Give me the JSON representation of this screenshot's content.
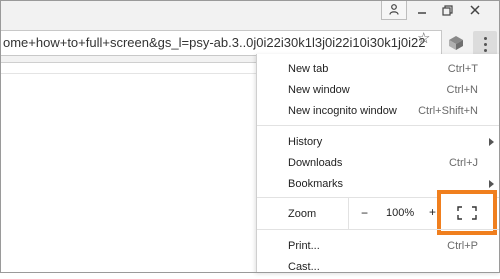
{
  "window": {
    "controls": [
      "user-icon",
      "minimize-icon",
      "maximize-icon",
      "close-icon"
    ]
  },
  "toolbar": {
    "url": "ome+how+to+full+screen&gs_l=psy-ab.3..0j0i22i30k1l3j0i22i10i30k1j0i22",
    "icons": [
      "star-icon",
      "extension-icon",
      "menu-icon"
    ]
  },
  "menu": {
    "new_tab": {
      "label": "New tab",
      "shortcut": "Ctrl+T"
    },
    "new_window": {
      "label": "New window",
      "shortcut": "Ctrl+N"
    },
    "new_incognito": {
      "label": "New incognito window",
      "shortcut": "Ctrl+Shift+N"
    },
    "history": {
      "label": "History"
    },
    "downloads": {
      "label": "Downloads",
      "shortcut": "Ctrl+J"
    },
    "bookmarks": {
      "label": "Bookmarks"
    },
    "zoom": {
      "label": "Zoom",
      "minus": "−",
      "value": "100%",
      "plus": "+"
    },
    "print": {
      "label": "Print...",
      "shortcut": "Ctrl+P"
    },
    "cast": {
      "label": "Cast..."
    }
  },
  "highlight_color": "#f07f1e"
}
